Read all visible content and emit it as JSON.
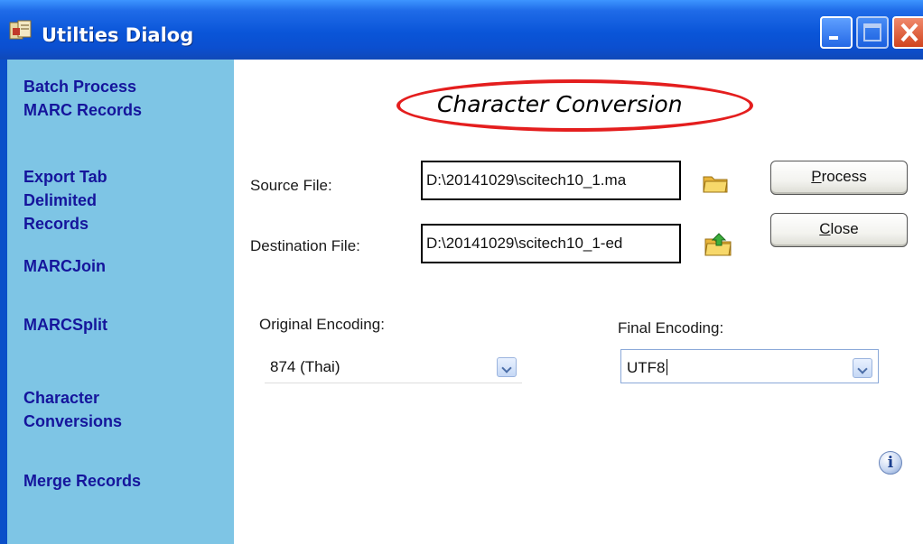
{
  "window": {
    "title": "Utilties Dialog"
  },
  "sidebar": {
    "items": [
      {
        "line1": "Batch Process",
        "line2": "MARC Records"
      },
      {
        "line1": "Export Tab",
        "line2": "Delimited",
        "line3": "Records"
      },
      {
        "line1": "MARCJoin"
      },
      {
        "line1": "MARCSplit"
      },
      {
        "line1": "Character",
        "line2": "Conversions"
      },
      {
        "line1": "Merge Records"
      }
    ]
  },
  "main": {
    "title": "Character Conversion",
    "source_label": "Source File:",
    "source_value": "D:\\20141029\\scitech10_1.ma",
    "destination_label": "Destination File:",
    "destination_value": "D:\\20141029\\scitech10_1-ed",
    "process_button": {
      "mnemonic": "P",
      "rest": "rocess"
    },
    "close_button": {
      "mnemonic": "C",
      "rest": "lose"
    },
    "original_encoding_label": "Original Encoding:",
    "original_encoding_value": "874 (Thai)",
    "final_encoding_label": "Final Encoding:",
    "final_encoding_value": "UTF8"
  },
  "colors": {
    "titlebar": "#0a55d8",
    "sidebar": "#7ec5e5",
    "nav_text": "#15159c",
    "highlight": "#e41e1e"
  }
}
